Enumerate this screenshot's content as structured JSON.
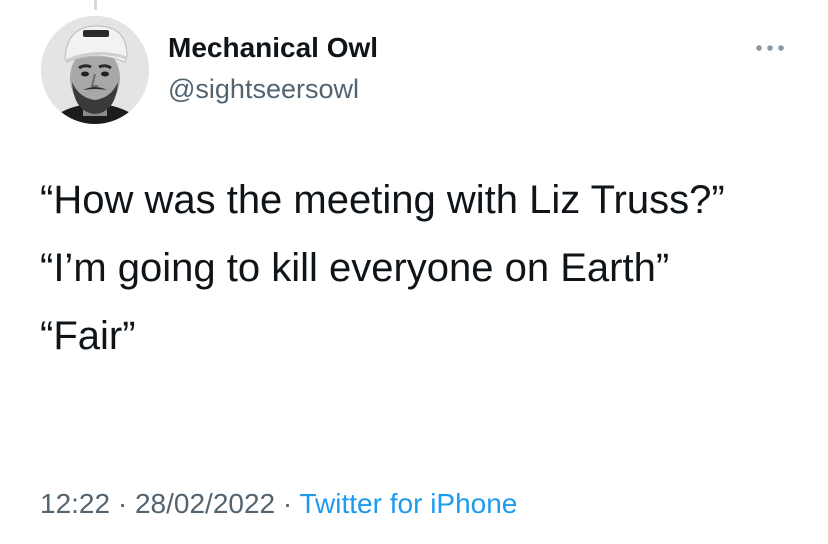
{
  "author": {
    "display_name": "Mechanical Owl",
    "handle": "@sightseersowl",
    "avatar_icon": "profile-photo-man-in-cap"
  },
  "tweet": {
    "paragraphs": [
      "“How was the meeting with Liz Truss?”",
      "“I’m going to kill everyone on Earth”",
      "“Fair”"
    ],
    "time": "12:22",
    "separator": "·",
    "date": "28/02/2022",
    "source": "Twitter for iPhone"
  },
  "icons": {
    "more": "more-options-icon"
  },
  "colors": {
    "text": "#0f1419",
    "secondary": "#536471",
    "link": "#1d9bf0"
  }
}
